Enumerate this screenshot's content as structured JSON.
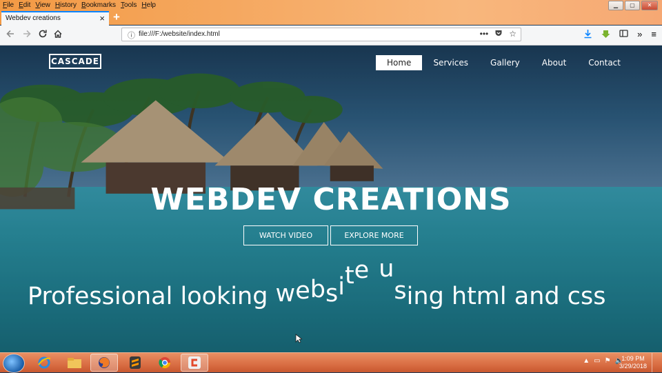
{
  "browser": {
    "menu": [
      "File",
      "Edit",
      "View",
      "History",
      "Bookmarks",
      "Tools",
      "Help"
    ],
    "tab_title": "Webdev creations",
    "tab_close": "×",
    "new_tab": "+",
    "url": "file:///F:/website/index.html",
    "page_actions": "•••"
  },
  "site": {
    "logo": "CASCADE",
    "nav": [
      "Home",
      "Services",
      "Gallery",
      "About",
      "Contact"
    ],
    "hero_title": "WEBDEV CREATIONS",
    "buttons": {
      "watch": "WATCH VIDEO",
      "explore": "EXPLORE MORE"
    },
    "tagline": {
      "before": "Professional looking ",
      "animated": [
        "w",
        "e",
        "b",
        "s",
        "i",
        "t",
        "e",
        " ",
        "u",
        "s"
      ],
      "after": "ing html and css"
    }
  },
  "taskbar": {
    "time": "1:09 PM",
    "date": "3/29/2018"
  },
  "colors": {
    "tab_accent": "#0a84ff",
    "nav_active_bg": "#ffffff",
    "taskbar": "#d96d43"
  }
}
